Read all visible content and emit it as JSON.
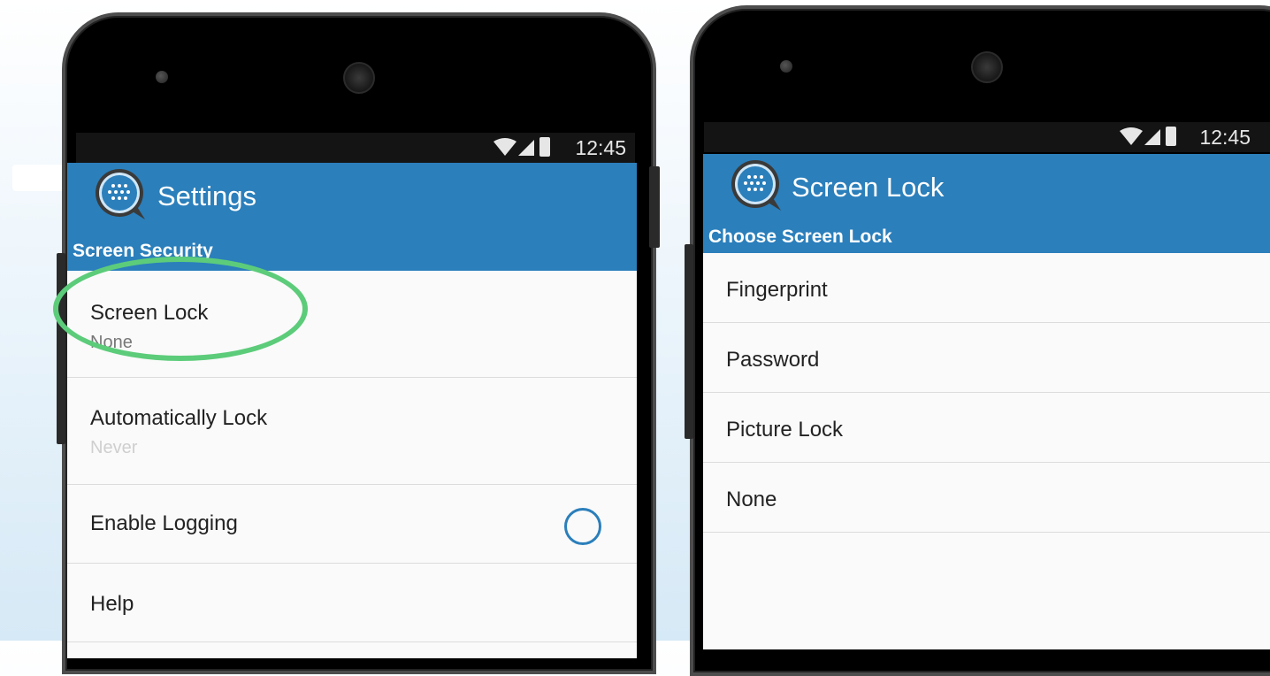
{
  "left_phone": {
    "status": {
      "time": "12:45"
    },
    "app_bar": {
      "title": "Settings",
      "subtitle": "Screen Security"
    },
    "items": [
      {
        "title": "Screen Lock",
        "subtitle": "None"
      },
      {
        "title": "Automatically Lock",
        "subtitle": "Never"
      },
      {
        "title": "Enable Logging",
        "toggle": false
      },
      {
        "title": "Help"
      }
    ],
    "colors": {
      "accent": "#2b7fbb",
      "highlight": "#5ccc7a"
    }
  },
  "right_phone": {
    "status": {
      "time": "12:45"
    },
    "app_bar": {
      "title": "Screen Lock",
      "subtitle": "Choose Screen Lock"
    },
    "items": [
      {
        "title": "Fingerprint"
      },
      {
        "title": "Password"
      },
      {
        "title": "Picture Lock"
      },
      {
        "title": "None"
      }
    ]
  }
}
